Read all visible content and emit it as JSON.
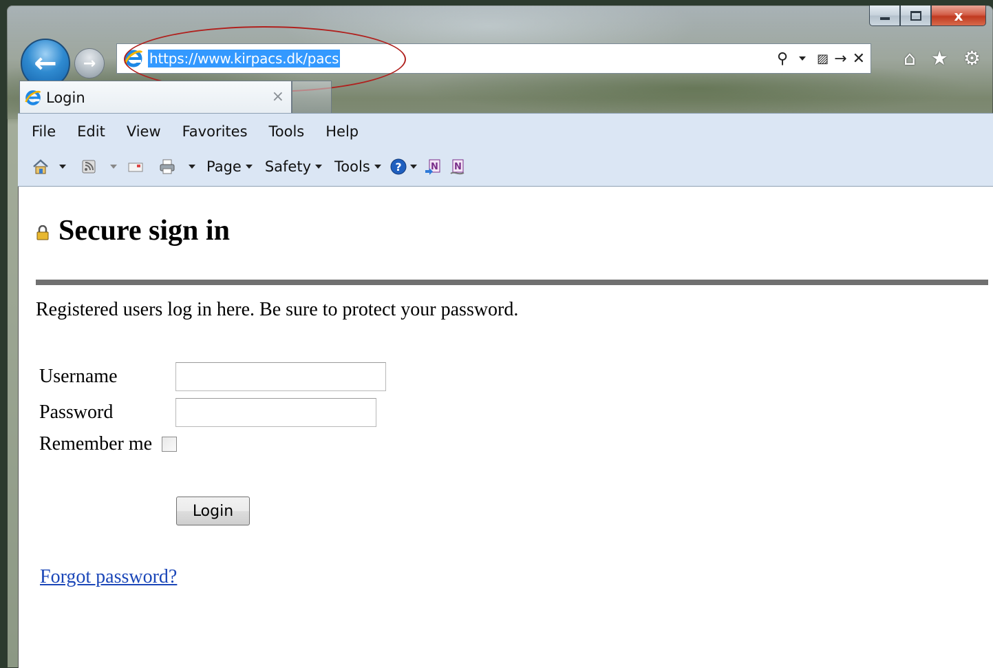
{
  "browser": {
    "address_url": "https://www.kirpacs.dk/pacs",
    "tab_title": "Login",
    "tab_close": "×",
    "caption_close": "x"
  },
  "menubar": {
    "items": [
      "File",
      "Edit",
      "View",
      "Favorites",
      "Tools",
      "Help"
    ]
  },
  "commandbar": {
    "page_label": "Page",
    "safety_label": "Safety",
    "tools_label": "Tools"
  },
  "page": {
    "heading": "Secure sign in",
    "intro": "Registered users log in here. Be sure to protect your password.",
    "username_label": "Username",
    "username_value": "",
    "password_label": "Password",
    "password_value": "",
    "remember_label": "Remember me",
    "remember_checked": false,
    "login_button": "Login",
    "forgot_link": "Forgot password?"
  },
  "colors": {
    "selection": "#3399ff",
    "annotation": "#b0201d",
    "link": "#1a46b8"
  }
}
